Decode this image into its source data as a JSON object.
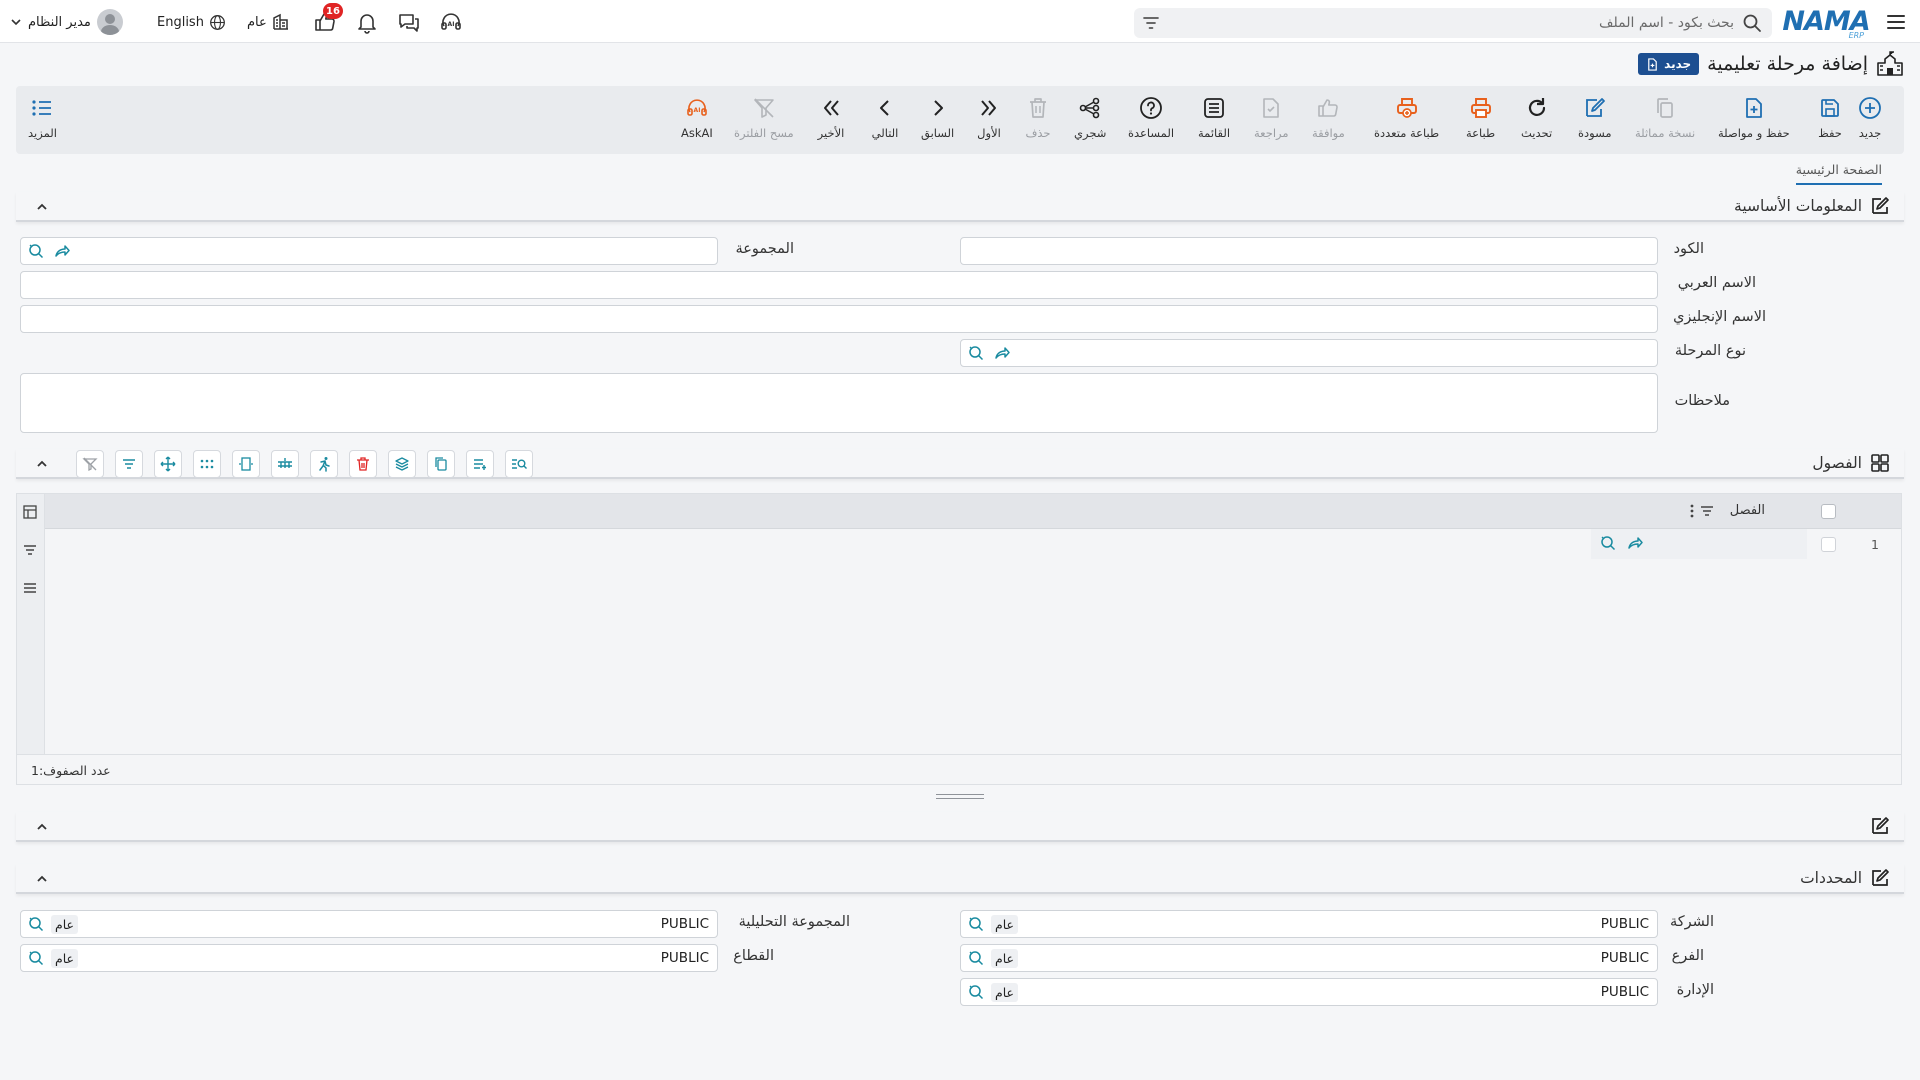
{
  "app": {
    "logo_text": "NAMA",
    "logo_sub": "ERP",
    "brand_color": "#1f6fb2"
  },
  "topbar": {
    "search_placeholder": "بحث بكود - اسم الملف",
    "user_name": "مدير النظام",
    "language": "English",
    "department": "عام",
    "notification_count": "16"
  },
  "page": {
    "title": "إضافة مرحلة تعليمية",
    "status_badge": "جديد"
  },
  "toolbar": {
    "new": "جديد",
    "save": "حفظ",
    "save_continue": "حفظ و مواصلة",
    "duplicate": "نسخة مماثلة",
    "draft": "مسودة",
    "refresh": "تحديث",
    "print": "طباعة",
    "multi_print": "طباعة متعددة",
    "approve": "موافقة",
    "review": "مراجعة",
    "list": "القائمة",
    "help": "المساعدة",
    "tree": "شجري",
    "delete": "حذف",
    "first": "الأول",
    "previous": "السابق",
    "next": "التالي",
    "last": "الأخير",
    "clear_filter": "مسح الفلترة",
    "ask_ai": "AskAI",
    "more": "المزيد"
  },
  "tabs": {
    "main": "الصفحة الرئيسية"
  },
  "basic_info": {
    "title": "المعلومات الأساسية",
    "code_label": "الكود",
    "group_label": "المجموعة",
    "arabic_name_label": "الاسم العربي",
    "english_name_label": "الاسم الإنجليزي",
    "stage_type_label": "نوع المرحلة",
    "notes_label": "ملاحظات"
  },
  "classes": {
    "title": "الفصول",
    "column_header": "الفصل",
    "rows": [
      {
        "num": "1",
        "value": ""
      }
    ],
    "row_count_label": "عدد الصفوف:",
    "row_count": "1"
  },
  "determinants": {
    "title": "المحددات",
    "company_label": "الشركة",
    "company_value": "PUBLIC",
    "company_tag": "عام",
    "branch_label": "الفرع",
    "branch_value": "PUBLIC",
    "branch_tag": "عام",
    "department_label": "الإدارة",
    "department_value": "PUBLIC",
    "department_tag": "عام",
    "analytic_group_label": "المجموعة التحليلية",
    "analytic_group_value": "PUBLIC",
    "analytic_group_tag": "عام",
    "sector_label": "القطاع",
    "sector_value": "PUBLIC",
    "sector_tag": "عام"
  },
  "colors": {
    "accent_blue": "#1f6fb2",
    "badge_blue": "#1d4f91",
    "print_orange": "#e8601c",
    "teal_icon": "#1a8ba0",
    "notification_red": "#e02424"
  }
}
